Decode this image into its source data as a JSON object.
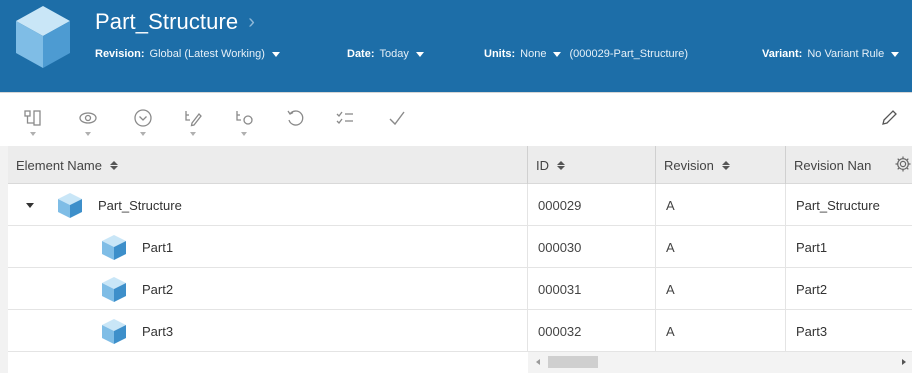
{
  "header": {
    "title": "Part_Structure",
    "revision": {
      "label": "Revision:",
      "value": "Global (Latest Working)"
    },
    "date": {
      "label": "Date:",
      "value": "Today"
    },
    "units": {
      "label": "Units:",
      "value": "None",
      "context": "(000029-Part_Structure)"
    },
    "variant": {
      "label": "Variant:",
      "value": "No Variant Rule"
    }
  },
  "toolbar": {
    "icons": [
      "structure-icon",
      "eye-icon",
      "chevron-circle-icon",
      "edit-structure-icon",
      "link-structure-icon",
      "undo-icon",
      "checklist-icon",
      "checkmark-icon",
      "pencil-icon"
    ]
  },
  "table": {
    "columns": [
      "Element Name",
      "ID",
      "Revision",
      "Revision Nan"
    ],
    "rows": [
      {
        "name": "Part_Structure",
        "id": "000029",
        "revision": "A",
        "revision_name": "Part_Structure"
      },
      {
        "name": "Part1",
        "id": "000030",
        "revision": "A",
        "revision_name": "Part1"
      },
      {
        "name": "Part2",
        "id": "000031",
        "revision": "A",
        "revision_name": "Part2"
      },
      {
        "name": "Part3",
        "id": "000032",
        "revision": "A",
        "revision_name": "Part3"
      }
    ]
  },
  "colors": {
    "header_bg": "#1d6ea8",
    "cube_light": "#a9d4ee",
    "cube_mid": "#5fa7d8",
    "cube_dark": "#2e7bb8"
  }
}
